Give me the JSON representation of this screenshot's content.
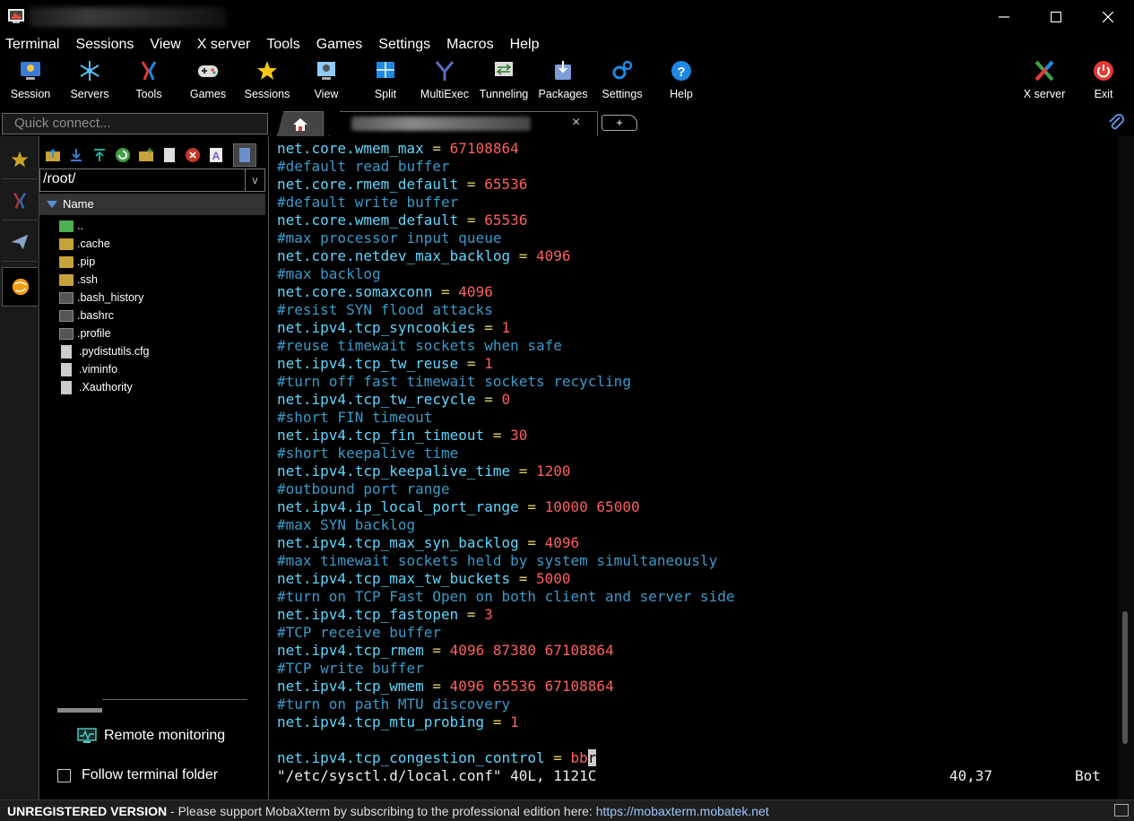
{
  "menu": [
    "Terminal",
    "Sessions",
    "View",
    "X server",
    "Tools",
    "Games",
    "Settings",
    "Macros",
    "Help"
  ],
  "toolbar": {
    "session": "Session",
    "servers": "Servers",
    "tools": "Tools",
    "games": "Games",
    "sessions": "Sessions",
    "view": "View",
    "split": "Split",
    "multiexec": "MultiExec",
    "tunneling": "Tunneling",
    "packages": "Packages",
    "settings": "Settings",
    "help": "Help",
    "xserver": "X server",
    "exit": "Exit"
  },
  "quick_connect": {
    "placeholder": "Quick connect..."
  },
  "tabs": {
    "close": "×",
    "add": "+"
  },
  "sftp": {
    "path": "/root/",
    "dropdown": "v",
    "column_name": "Name",
    "files": [
      {
        "name": "..",
        "type": "parent"
      },
      {
        "name": ".cache",
        "type": "folder"
      },
      {
        "name": ".pip",
        "type": "folder"
      },
      {
        "name": ".ssh",
        "type": "folder"
      },
      {
        "name": ".bash_history",
        "type": "term"
      },
      {
        "name": ".bashrc",
        "type": "term"
      },
      {
        "name": ".profile",
        "type": "term"
      },
      {
        "name": ".pydistutils.cfg",
        "type": "doc"
      },
      {
        "name": ".viminfo",
        "type": "doc"
      },
      {
        "name": ".Xauthority",
        "type": "doc"
      }
    ],
    "remote_monitoring": "Remote monitoring",
    "follow_folder": "Follow terminal folder"
  },
  "terminal": {
    "lines": [
      {
        "k": "net.core.wmem_max",
        "v": "67108864"
      },
      {
        "c": "#default read buffer"
      },
      {
        "k": "net.core.rmem_default",
        "v": "65536"
      },
      {
        "c": "#default write buffer"
      },
      {
        "k": "net.core.wmem_default",
        "v": "65536"
      },
      {
        "c": "#max processor input queue"
      },
      {
        "k": "net.core.netdev_max_backlog",
        "v": "4096"
      },
      {
        "c": "#max backlog"
      },
      {
        "k": "net.core.somaxconn",
        "v": "4096"
      },
      {
        "c": "#resist SYN flood attacks"
      },
      {
        "k": "net.ipv4.tcp_syncookies",
        "v": "1"
      },
      {
        "c": "#reuse timewait sockets when safe"
      },
      {
        "k": "net.ipv4.tcp_tw_reuse",
        "v": "1"
      },
      {
        "c": "#turn off fast timewait sockets recycling"
      },
      {
        "k": "net.ipv4.tcp_tw_recycle",
        "v": "0"
      },
      {
        "c": "#short FIN timeout"
      },
      {
        "k": "net.ipv4.tcp_fin_timeout",
        "v": "30"
      },
      {
        "c": "#short keepalive time"
      },
      {
        "k": "net.ipv4.tcp_keepalive_time",
        "v": "1200"
      },
      {
        "c": "#outbound port range"
      },
      {
        "k": "net.ipv4.ip_local_port_range",
        "v": "10000 65000"
      },
      {
        "c": "#max SYN backlog"
      },
      {
        "k": "net.ipv4.tcp_max_syn_backlog",
        "v": "4096"
      },
      {
        "c": "#max timewait sockets held by system simultaneously"
      },
      {
        "k": "net.ipv4.tcp_max_tw_buckets",
        "v": "5000"
      },
      {
        "c": "#turn on TCP Fast Open on both client and server side"
      },
      {
        "k": "net.ipv4.tcp_fastopen",
        "v": "3"
      },
      {
        "c": "#TCP receive buffer"
      },
      {
        "k": "net.ipv4.tcp_rmem",
        "v": "4096 87380 67108864"
      },
      {
        "c": "#TCP write buffer"
      },
      {
        "k": "net.ipv4.tcp_wmem",
        "v": "4096 65536 67108864"
      },
      {
        "c": "#turn on path MTU discovery"
      },
      {
        "k": "net.ipv4.tcp_mtu_probing",
        "v": "1"
      },
      {
        "blank": true
      },
      {
        "k": "net.ipv4.tcp_congestion_control",
        "v": "bb",
        "cur": "r"
      }
    ],
    "eq": " = ",
    "status_file": "\"/etc/sysctl.d/local.conf\" 40L, 1121C",
    "status_pos": "40,37",
    "status_where": "Bot"
  },
  "bottom": {
    "unregistered": "UNREGISTERED VERSION",
    "message": "  -  Please support MobaXterm by subscribing to the professional edition here:  ",
    "link": "https://mobaxterm.mobatek.net"
  },
  "colors": {
    "key": "#5fd7ff",
    "equals": "#e0d060",
    "value": "#ff5f5f",
    "comment": "#3a9ac9"
  }
}
